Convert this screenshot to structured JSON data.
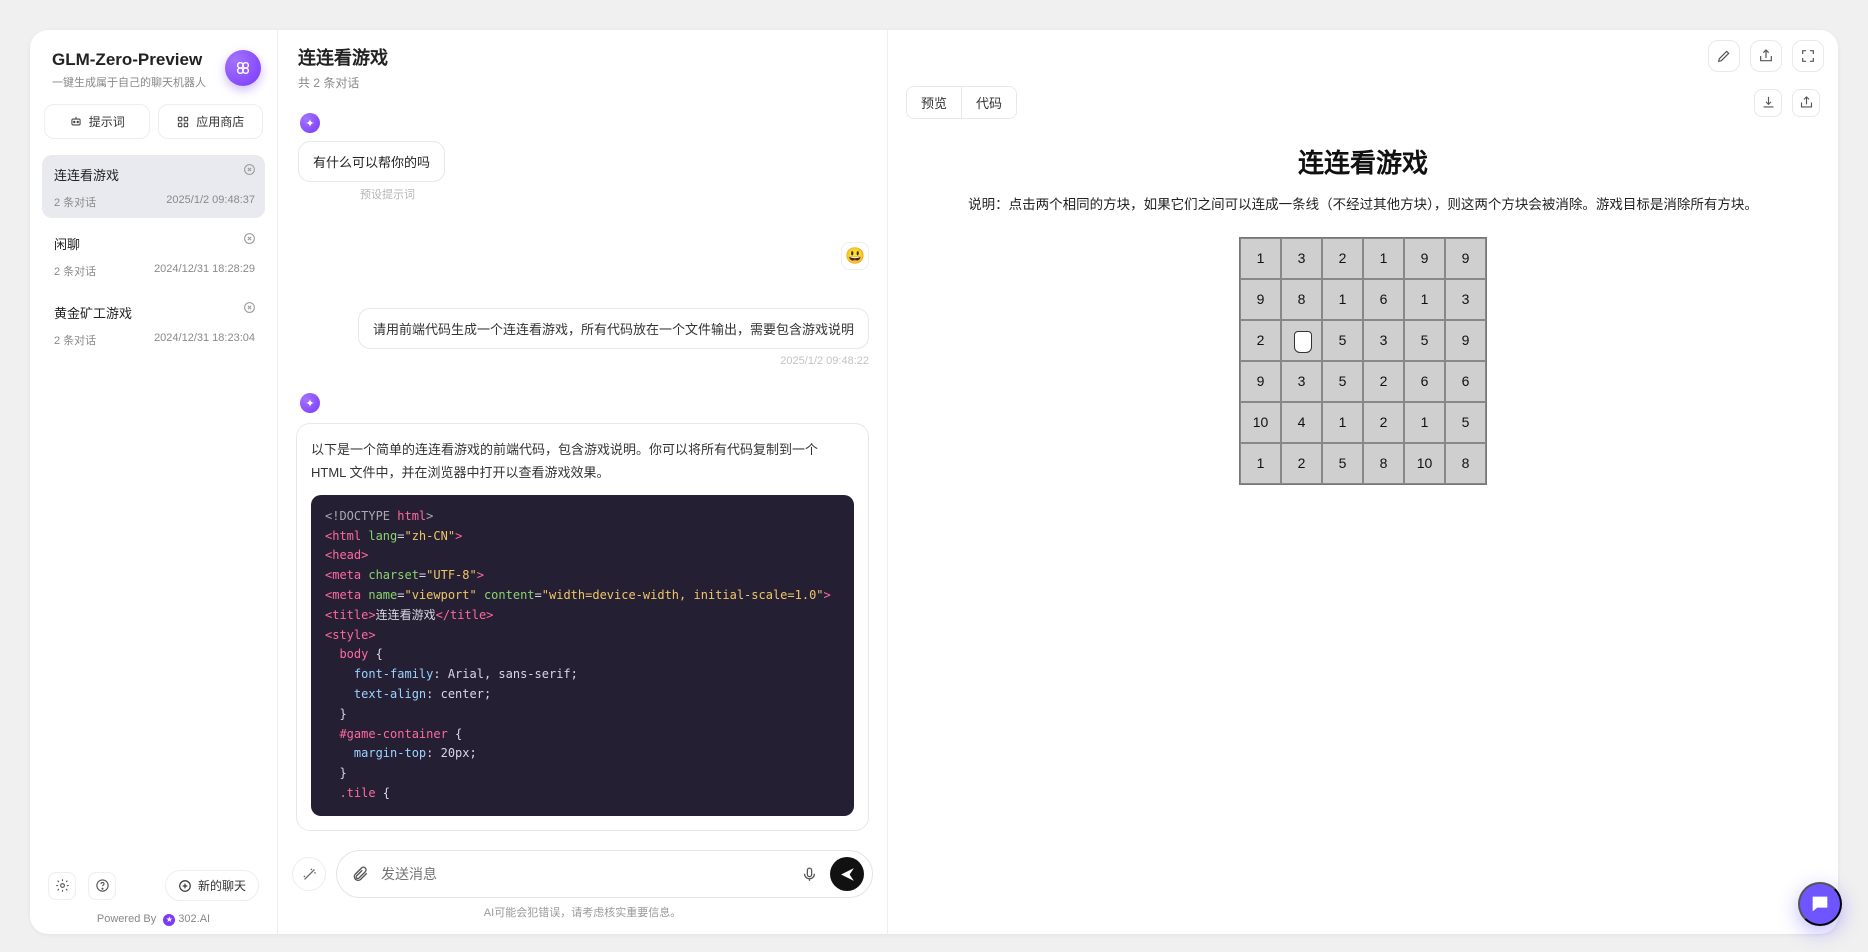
{
  "sidebar": {
    "title": "GLM-Zero-Preview",
    "subtitle": "一键生成属于自己的聊天机器人",
    "tab_prompt": "提示词",
    "tab_store": "应用商店",
    "conversations": [
      {
        "title": "连连看游戏",
        "count": "2 条对话",
        "time": "2025/1/2 09:48:37",
        "active": true
      },
      {
        "title": "闲聊",
        "count": "2 条对话",
        "time": "2024/12/31 18:28:29",
        "active": false
      },
      {
        "title": "黄金矿工游戏",
        "count": "2 条对话",
        "time": "2024/12/31 18:23:04",
        "active": false
      }
    ],
    "new_chat": "新的聊天",
    "powered_prefix": "Powered By",
    "powered_brand": "302.AI"
  },
  "chat": {
    "title": "连连看游戏",
    "subtitle": "共 2 条对话",
    "messages": {
      "assistant_greeting": "有什么可以帮你的吗",
      "placeholder_note": "预设提示词",
      "user_emoji": "😃",
      "user_prompt": "请用前端代码生成一个连连看游戏，所有代码放在一个文件输出，需要包含游戏说明",
      "user_time": "2025/1/2 09:48:22",
      "assistant_intro": "以下是一个简单的连连看游戏的前端代码，包含游戏说明。你可以将所有代码复制到一个 HTML 文件中，并在浏览器中打开以查看游戏效果。"
    },
    "code_lines": [
      {
        "doc": "<!DOCTYPE ",
        "tag": "html",
        "doc2": ">"
      },
      {
        "open": "html",
        "attr": " lang",
        "val": "\"zh-CN\""
      },
      {
        "open": "head"
      },
      {
        "selfopen": "meta",
        "attr": " charset",
        "val": "\"UTF-8\""
      },
      {
        "selfopen": "meta",
        "attr": " name",
        "val": "\"viewport\"",
        "attr2": " content",
        "val2": "\"width=device-width, initial-scale=1.0\""
      },
      {
        "open": "title",
        "text": "连连看游戏",
        "close": "title"
      },
      {
        "open": "style"
      },
      {
        "css_sel": "  body ",
        "brace": "{"
      },
      {
        "css_prop": "    font-family",
        "css_val": ": Arial, sans-serif;"
      },
      {
        "css_prop": "    text-align",
        "css_val": ": center;"
      },
      {
        "brace": "  }"
      },
      {
        "css_sel": "  #game-container ",
        "brace": "{"
      },
      {
        "css_prop": "    margin-top",
        "css_val": ": 20px;"
      },
      {
        "brace": "  }"
      },
      {
        "css_sel": "  .tile ",
        "brace": "{"
      }
    ],
    "composer": {
      "placeholder": "发送消息",
      "disclaimer": "AI可能会犯错误，请考虑核实重要信息。"
    }
  },
  "preview": {
    "tab_preview": "预览",
    "tab_code": "代码",
    "title": "连连看游戏",
    "description": "说明：点击两个相同的方块，如果它们之间可以连成一条线（不经过其他方块），则这两个方块会被消除。游戏目标是消除所有方块。",
    "board": [
      [
        "1",
        "3",
        "2",
        "1",
        "9",
        "9"
      ],
      [
        "9",
        "8",
        "1",
        "6",
        "1",
        "3"
      ],
      [
        "2",
        "",
        "5",
        "3",
        "5",
        "9"
      ],
      [
        "9",
        "3",
        "5",
        "2",
        "6",
        "6"
      ],
      [
        "10",
        "4",
        "1",
        "2",
        "1",
        "5"
      ],
      [
        "1",
        "2",
        "5",
        "8",
        "10",
        "8"
      ]
    ]
  }
}
